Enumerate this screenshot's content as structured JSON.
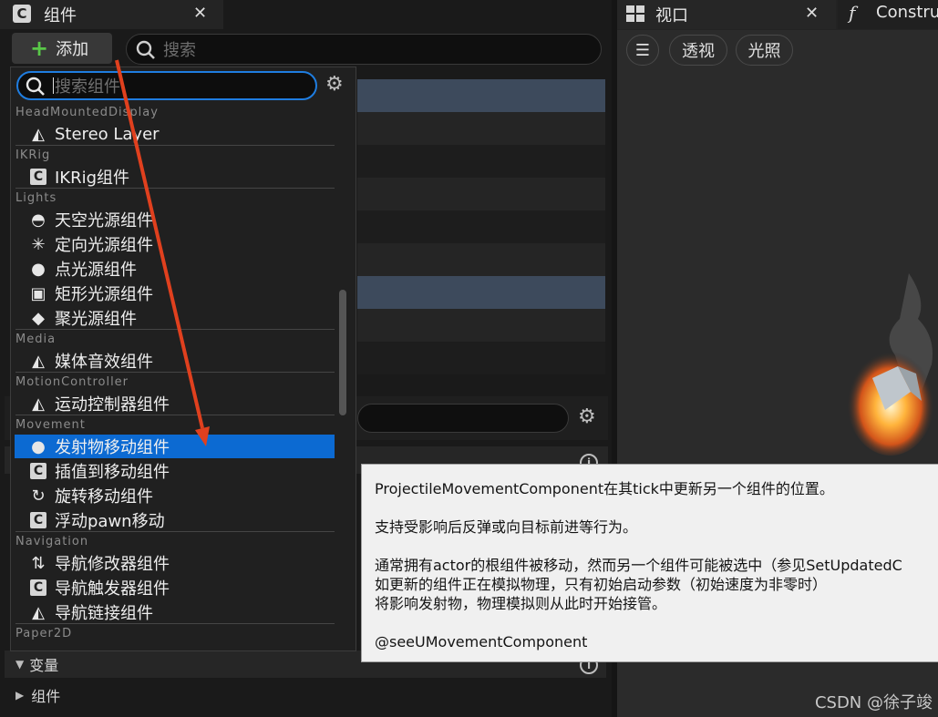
{
  "tabs": {
    "components": "组件",
    "viewport": "视口",
    "construct": "Constru"
  },
  "toolbar": {
    "add_label": "添加",
    "search_placeholder": "搜索"
  },
  "dropdown": {
    "search_placeholder": "搜索组件",
    "categories": [
      {
        "name": "HeadMountedDisplay",
        "items": [
          {
            "label": "Stereo Layer",
            "icon": "actor-component-icon"
          }
        ]
      },
      {
        "name": "IKRig",
        "items": [
          {
            "label": "IKRig组件",
            "icon": "scene-component-icon"
          }
        ]
      },
      {
        "name": "Lights",
        "items": [
          {
            "label": "天空光源组件",
            "icon": "sky-light-icon"
          },
          {
            "label": "定向光源组件",
            "icon": "directional-light-icon"
          },
          {
            "label": "点光源组件",
            "icon": "point-light-icon"
          },
          {
            "label": "矩形光源组件",
            "icon": "rect-light-icon"
          },
          {
            "label": "聚光源组件",
            "icon": "spot-light-icon"
          }
        ]
      },
      {
        "name": "Media",
        "items": [
          {
            "label": "媒体音效组件",
            "icon": "actor-component-icon"
          }
        ]
      },
      {
        "name": "MotionController",
        "items": [
          {
            "label": "运动控制器组件",
            "icon": "actor-component-icon"
          }
        ]
      },
      {
        "name": "Movement",
        "items": [
          {
            "label": "发射物移动组件",
            "icon": "projectile-icon"
          },
          {
            "label": "插值到移动组件",
            "icon": "scene-component-icon"
          },
          {
            "label": "旋转移动组件",
            "icon": "rotating-movement-icon"
          },
          {
            "label": "浮动pawn移动",
            "icon": "scene-component-icon"
          }
        ]
      },
      {
        "name": "Navigation",
        "items": [
          {
            "label": "导航修改器组件",
            "icon": "nav-modifier-icon"
          },
          {
            "label": "导航触发器组件",
            "icon": "scene-component-icon"
          },
          {
            "label": "导航链接组件",
            "icon": "actor-component-icon"
          }
        ]
      },
      {
        "name": "Paper2D",
        "items": []
      }
    ],
    "selected": "发射物移动组件"
  },
  "details": {
    "variables_label": "变量",
    "components_label": "组件"
  },
  "viewport": {
    "menu_icon": "hamburger-icon",
    "perspective_label": "透视",
    "lighting_label": "光照"
  },
  "tooltip": {
    "line1": "ProjectileMovementComponent在其tick中更新另一个组件的位置。",
    "line2": "支持受影响后反弹或向目标前进等行为。",
    "line3a": "通常拥有actor的根组件被移动，然而另一个组件可能被选中（参见SetUpdatedC",
    "line3b": "如更新的组件正在模拟物理，只有初始启动参数（初始速度为非零时）",
    "line3c": "将影响发射物，物理模拟则从此时开始接管。",
    "line4": "@seeUMovementComponent"
  },
  "watermark": "CSDN @徐子竣",
  "colors": {
    "selection": "#0c6ad2",
    "accent_border": "#1f7de0",
    "arrow": "#e0401e",
    "add_plus": "#59c748"
  }
}
